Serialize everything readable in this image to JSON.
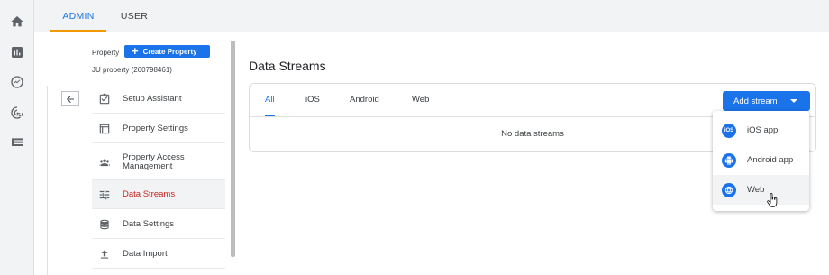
{
  "rail": {
    "icons": [
      "home-icon",
      "reports-icon",
      "explore-icon",
      "advertising-icon",
      "configure-icon"
    ]
  },
  "top_tabs": [
    {
      "label": "ADMIN",
      "active": true
    },
    {
      "label": "USER",
      "active": false
    }
  ],
  "property": {
    "label": "Property",
    "create_button": "Create Property",
    "name": "JU property (260798461)"
  },
  "menu": [
    {
      "label": "Setup Assistant",
      "icon": "checklist-icon"
    },
    {
      "label": "Property Settings",
      "icon": "settings-panel-icon"
    },
    {
      "label": "Property Access Management",
      "icon": "people-icon"
    },
    {
      "label": "Data Streams",
      "icon": "streams-icon",
      "active": true
    },
    {
      "label": "Data Settings",
      "icon": "database-icon"
    },
    {
      "label": "Data Import",
      "icon": "upload-icon"
    }
  ],
  "main": {
    "title": "Data Streams",
    "tabs": [
      {
        "label": "All",
        "active": true
      },
      {
        "label": "iOS"
      },
      {
        "label": "Android"
      },
      {
        "label": "Web"
      }
    ],
    "add_stream_button": "Add stream",
    "empty_message": "No data streams"
  },
  "dropdown": {
    "items": [
      {
        "label": "iOS app",
        "icon": "ios-icon",
        "badge": "iOS"
      },
      {
        "label": "Android app",
        "icon": "android-icon"
      },
      {
        "label": "Web",
        "icon": "globe-icon",
        "hovered": true
      }
    ]
  },
  "colors": {
    "accent": "#1a73e8",
    "active_tab_underline": "#f29900",
    "active_menu_text": "#c5221f"
  }
}
